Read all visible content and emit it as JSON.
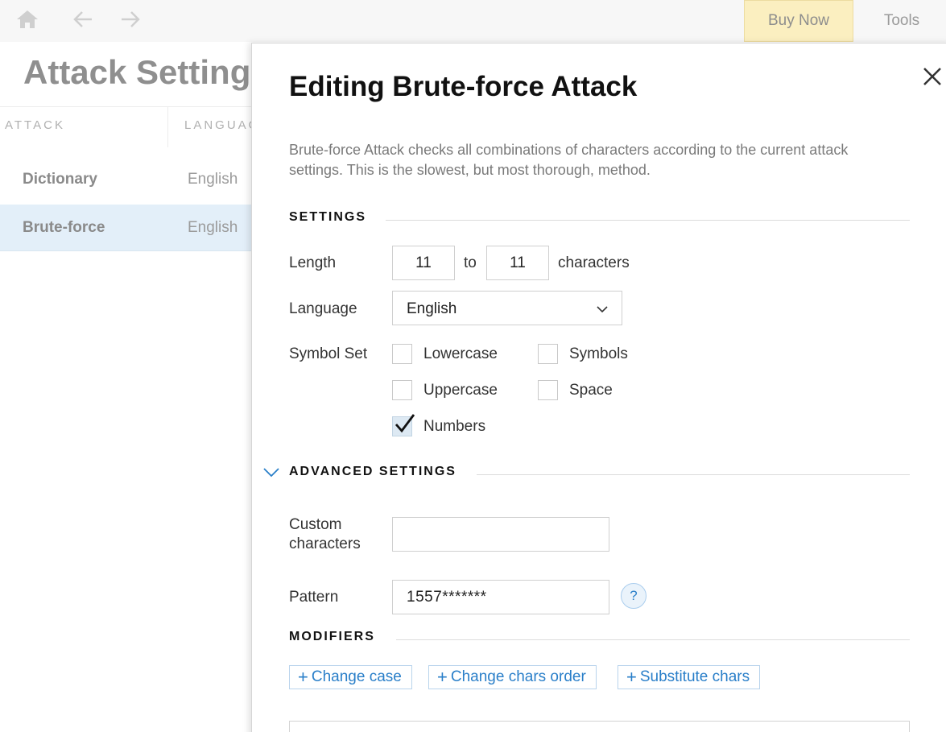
{
  "topbar": {
    "buy_now_label": "Buy Now",
    "tools_label": "Tools"
  },
  "page": {
    "title": "Attack Setting"
  },
  "table": {
    "headers": [
      "ATTACK",
      "LANGUAG"
    ],
    "rows": [
      {
        "name": "Dictionary",
        "language": "English",
        "selected": false
      },
      {
        "name": "Brute-force",
        "language": "English",
        "selected": true
      }
    ]
  },
  "panel": {
    "title": "Editing Brute-force Attack",
    "description": "Brute-force Attack checks all combinations of characters according to the current attack settings. This is the slowest, but most thorough, method.",
    "settings": {
      "section_title": "SETTINGS",
      "length_label": "Length",
      "length_from": "11",
      "to_label": "to",
      "length_to": "11",
      "characters_label": "characters",
      "language_label": "Language",
      "language_value": "English",
      "symbol_set_label": "Symbol Set",
      "symbols": [
        {
          "label": "Lowercase",
          "checked": false
        },
        {
          "label": "Symbols",
          "checked": false
        },
        {
          "label": "Uppercase",
          "checked": false
        },
        {
          "label": "Space",
          "checked": false
        },
        {
          "label": "Numbers",
          "checked": true
        }
      ]
    },
    "advanced": {
      "section_title": "ADVANCED SETTINGS",
      "custom_chars_label_line1": "Custom",
      "custom_chars_label_line2": "characters",
      "custom_chars_value": "",
      "pattern_label": "Pattern",
      "pattern_value": "1557*******",
      "help_label": "?"
    },
    "modifiers": {
      "section_title": "MODIFIERS",
      "buttons": [
        "Change case",
        "Change chars order",
        "Substitute chars"
      ]
    }
  },
  "colors": {
    "accent": "#2a7fc9",
    "selected_row": "#e3eff9",
    "buy_now_bg": "#fbefc0"
  }
}
